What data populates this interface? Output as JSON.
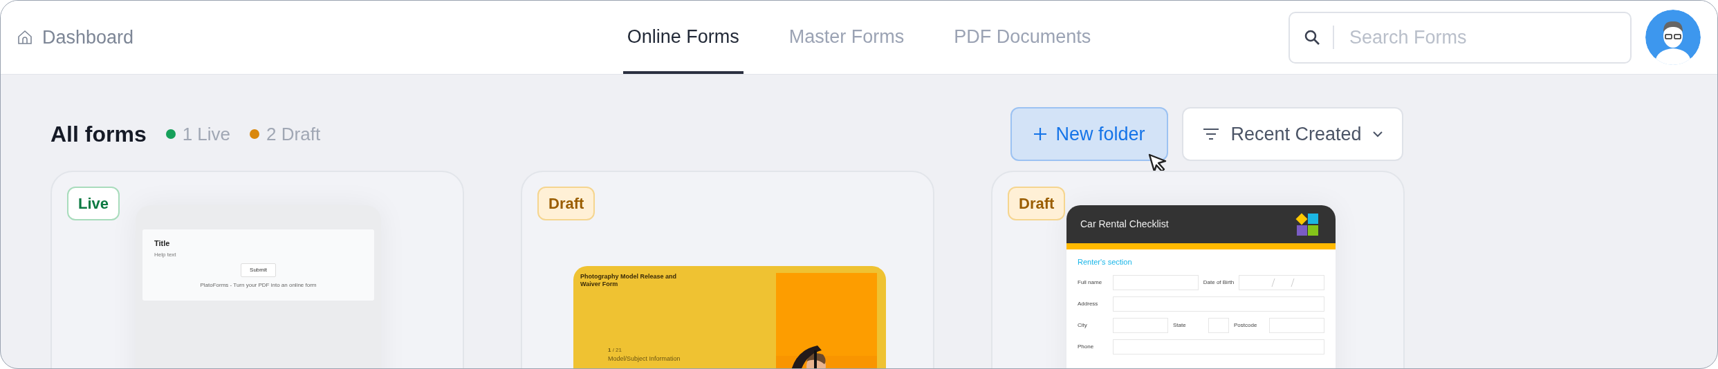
{
  "nav": {
    "home": "Dashboard",
    "tabs": [
      {
        "label": "Online Forms",
        "selected": true
      },
      {
        "label": "Master Forms",
        "selected": false
      },
      {
        "label": "PDF Documents",
        "selected": false
      }
    ]
  },
  "search": {
    "placeholder": "Search Forms"
  },
  "heading": {
    "title": "All forms",
    "counts": [
      {
        "label": "1 Live",
        "color": "#16a05a"
      },
      {
        "label": "2 Draft",
        "color": "#d9870b"
      }
    ]
  },
  "actions": {
    "new_folder": "New folder",
    "sort": "Recent Created"
  },
  "forms": [
    {
      "badge": {
        "label": "Live",
        "kind": "live"
      },
      "kind": "blank",
      "preview": {
        "title": "Title",
        "help": "Help text",
        "button": "Submit",
        "footer": "PlatoForms - Turn your PDF into an online form"
      }
    },
    {
      "badge": {
        "label": "Draft",
        "kind": "draft"
      },
      "preview": {
        "title": "Photography Model Release and Waiver Form",
        "step": "**1** / 21",
        "section": "Model/Subject Information"
      }
    },
    {
      "badge": {
        "label": "Draft",
        "kind": "draft"
      },
      "kind": "checklist",
      "preview": {
        "title": "Car Rental Checklist",
        "section": "Renter's section",
        "rows": [
          [
            {
              "label": "Full name"
            },
            {
              "label": "Date of Birth",
              "kind": "date"
            }
          ],
          [
            {
              "label": "Address"
            }
          ],
          [
            {
              "label": "City"
            },
            {
              "label": "State",
              "kind": "short"
            },
            {
              "label": "Postcode"
            }
          ],
          [
            {
              "label": "Phone"
            }
          ]
        ]
      }
    }
  ]
}
